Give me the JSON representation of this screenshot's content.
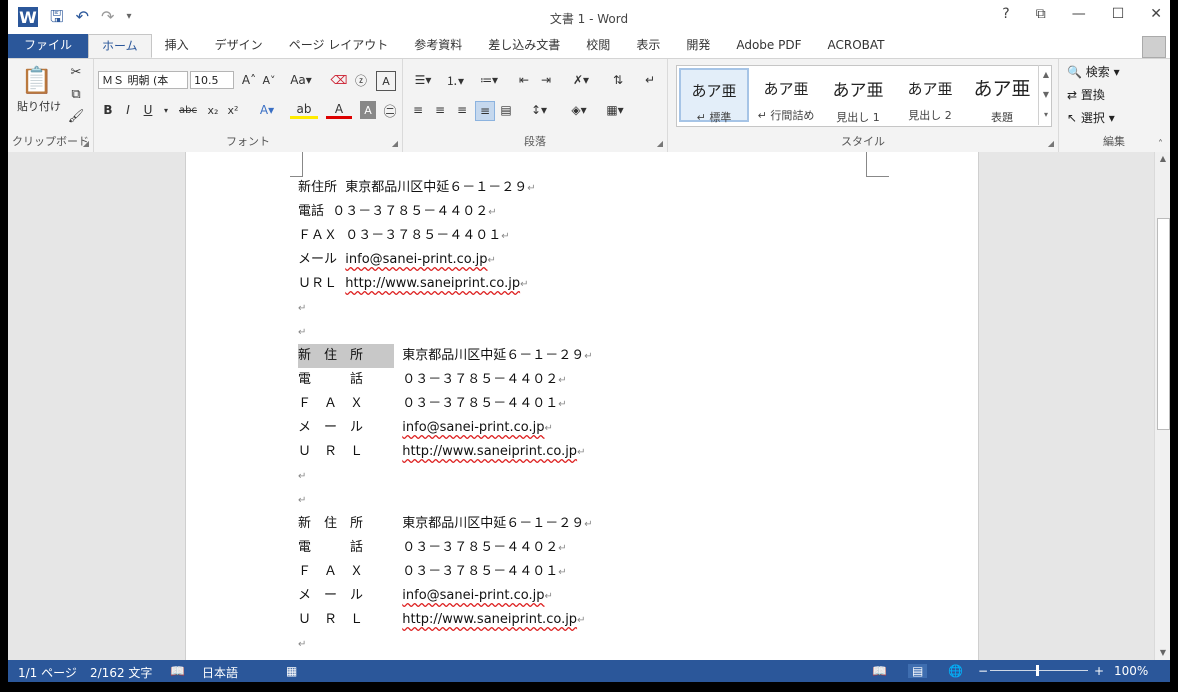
{
  "title": "文書 1 - Word",
  "window_controls": [
    "?",
    "⧉",
    "—",
    "☐",
    "✕"
  ],
  "tabs": [
    "ファイル",
    "ホーム",
    "挿入",
    "デザイン",
    "ページ レイアウト",
    "参考資料",
    "差し込み文書",
    "校閲",
    "表示",
    "開発",
    "Adobe PDF",
    "ACROBAT"
  ],
  "ribbon": {
    "clipboard": {
      "paste": "貼り付け",
      "label": "クリップボード"
    },
    "font": {
      "name": "ＭＳ 明朝 (本",
      "size": "10.5",
      "label": "フォント",
      "bold": "B",
      "italic": "I",
      "underline": "U"
    },
    "paragraph": {
      "label": "段落"
    },
    "styles": {
      "label": "スタイル",
      "items": [
        {
          "preview": "あア亜",
          "name": "↵ 標準"
        },
        {
          "preview": "あア亜",
          "name": "↵ 行間詰め"
        },
        {
          "preview": "あア亜",
          "name": "見出し 1"
        },
        {
          "preview": "あア亜",
          "name": "見出し 2"
        },
        {
          "preview": "あア亜",
          "name": "表題"
        }
      ]
    },
    "editing": {
      "label": "編集",
      "find": "検索",
      "replace": "置換",
      "select": "選択"
    }
  },
  "document": {
    "lines": [
      {
        "label": "新住所",
        "value": "東京都品川区中延６－１－２９",
        "link": false
      },
      {
        "label": "電話",
        "value": "０３－３７８５－４４０２",
        "link": false
      },
      {
        "label": "ＦＡＸ",
        "value": "０３－３７８５－４４０１",
        "link": false
      },
      {
        "label": "メール",
        "value": "info@sanei-print.co.jp",
        "link": true
      },
      {
        "label": "ＵＲＬ",
        "value": "http://www.saneiprint.co.jp",
        "link": true
      },
      {
        "label": "",
        "value": "",
        "link": false
      },
      {
        "label": "",
        "value": "",
        "link": false
      },
      {
        "label": "新　住　所",
        "value": "東京都品川区中延６－１－２９",
        "link": false
      },
      {
        "label": "電　　　話",
        "value": "０３－３７８５－４４０２",
        "link": false
      },
      {
        "label": "Ｆ　Ａ　Ｘ",
        "value": "０３－３７８５－４４０１",
        "link": false
      },
      {
        "label": "メ　ー　ル",
        "value": "info@sanei-print.co.jp",
        "link": true
      },
      {
        "label": "Ｕ　Ｒ　Ｌ",
        "value": "http://www.saneiprint.co.jp",
        "link": true
      },
      {
        "label": "",
        "value": "",
        "link": false
      },
      {
        "label": "",
        "value": "",
        "link": false
      },
      {
        "label": "新　住　所",
        "value": "東京都品川区中延６－１－２９",
        "link": false
      },
      {
        "label": "電　　　話",
        "value": "０３－３７８５－４４０２",
        "link": false
      },
      {
        "label": "Ｆ　Ａ　Ｘ",
        "value": "０３－３７８５－４４０１",
        "link": false
      },
      {
        "label": "メ　ー　ル",
        "value": "info@sanei-print.co.jp",
        "link": true
      },
      {
        "label": "Ｕ　Ｒ　Ｌ",
        "value": "http://www.saneiprint.co.jp",
        "link": true
      },
      {
        "label": "",
        "value": "",
        "link": false
      }
    ]
  },
  "status": {
    "page": "1/1 ページ",
    "words": "2/162 文字",
    "lang": "日本語",
    "zoom": "100%"
  }
}
